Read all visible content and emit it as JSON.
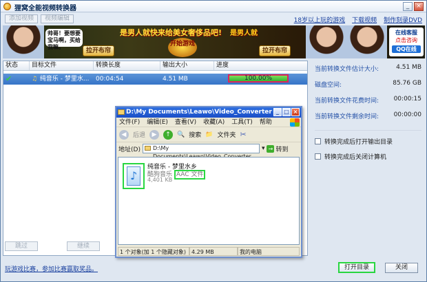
{
  "window": {
    "title": "狸窝全能视频转换器"
  },
  "topbar": {
    "add_video": "添加视频",
    "edit_video": "视频编辑",
    "links": [
      "18岁以上玩的游戏",
      "下载视频",
      "制作刻录DVD"
    ]
  },
  "banner": {
    "bubble": "帅哥！要想要宝马啊，买给我嘛。",
    "btn_left": "拉开布帘",
    "slogan": "是男人就快来给美女奢侈品吧!",
    "game": "开始游戏",
    "flag": "是男人就",
    "btn_right": "拉开布帘",
    "service_title": "在线客服",
    "service_link": "点击咨询",
    "qq": "QQ在线"
  },
  "filelist": {
    "headers": [
      "状态",
      "目标文件",
      "转换长度",
      "输出大小",
      "进度"
    ],
    "rows": [
      {
        "status_icon": "✔",
        "target": "纯音乐 - 梦里水...",
        "length": "00:04:54",
        "size": "4.51 MB",
        "progress_text": "100.00%",
        "progress": 1.0
      }
    ],
    "actions": [
      "跳过",
      "继续",
      "停止"
    ]
  },
  "stats": [
    {
      "label": "当前转换文件估计大小:",
      "value": "4.51 MB"
    },
    {
      "label": "磁盘空间:",
      "value": "85.76 GB"
    },
    {
      "label": "当前转换文件花费时间:",
      "value": "00:00:15"
    },
    {
      "label": "当前转换文件剩余时间:",
      "value": "00:00:00"
    }
  ],
  "options": [
    {
      "label": "转换完成后打开输出目录",
      "checked": false
    },
    {
      "label": "转换完成后关闭计算机",
      "checked": false
    }
  ],
  "footer": {
    "link": "玩游戏比赛，参加比赛赢取奖品。",
    "open_dir": "打开目录",
    "close": "关闭"
  },
  "explorer": {
    "title": "D:\\My Documents\\Leawo\\Video_Converter",
    "menu": [
      "文件(F)",
      "编辑(E)",
      "查看(V)",
      "收藏(A)",
      "工具(T)",
      "帮助"
    ],
    "toolbar": {
      "back": "后退",
      "search": "搜索",
      "folders": "文件夹"
    },
    "address_label": "地址(D)",
    "address": "D:\\My Documents\\Leawo\\Video_Converter",
    "go": "转到",
    "file": {
      "name": "纯音乐 - 梦里水乡",
      "app": "酷狗音乐",
      "type": "AAC 文件",
      "size": "4,401 KB"
    },
    "status": [
      "1 个对象(加 1 个隐藏对象)",
      "4.29 MB",
      "我的电脑"
    ]
  }
}
